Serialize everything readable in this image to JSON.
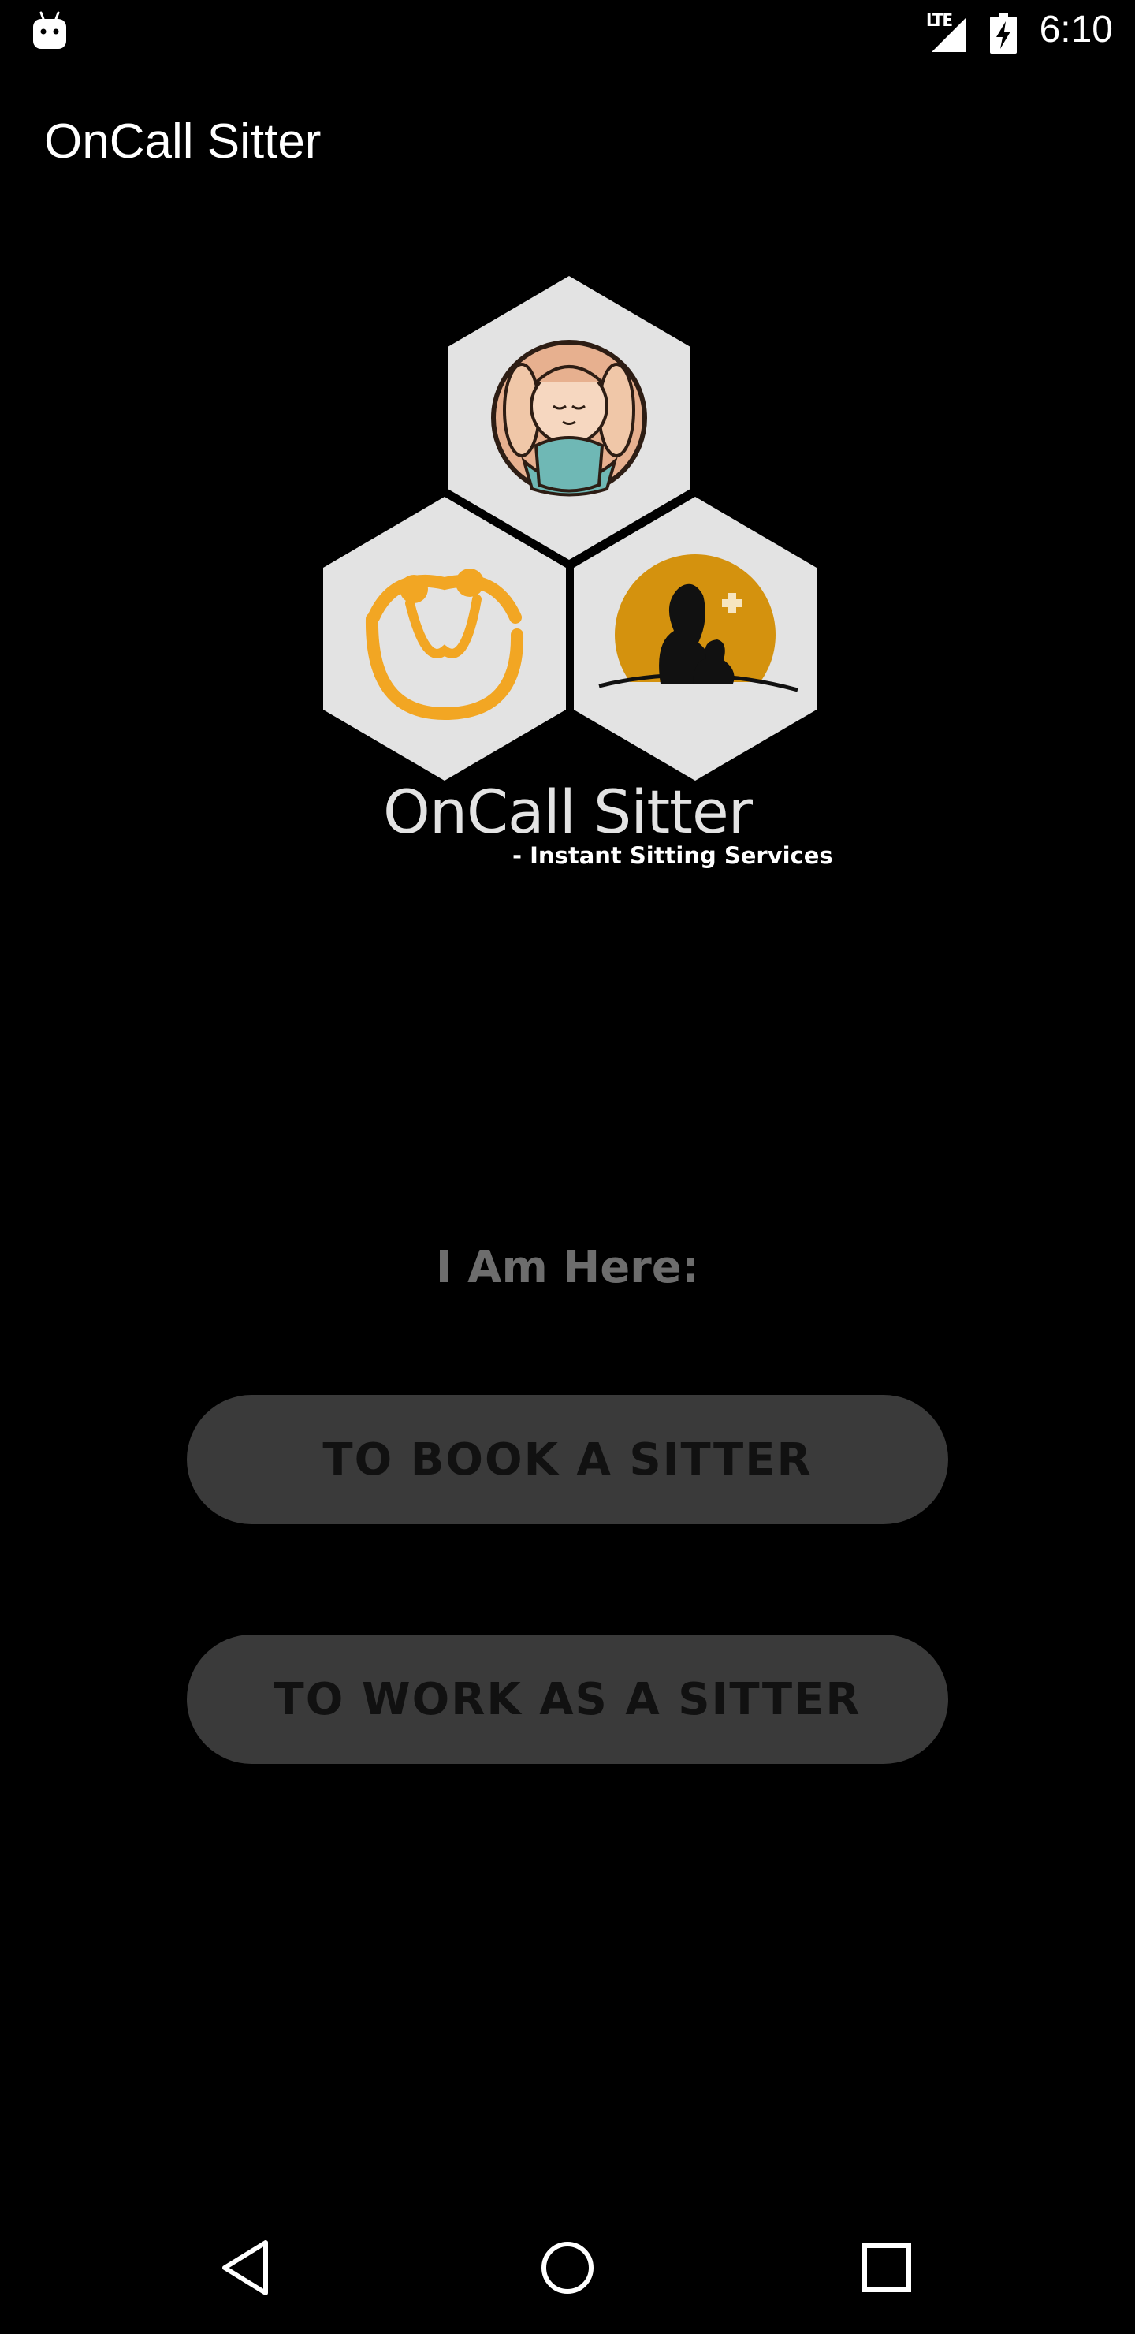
{
  "status_bar": {
    "network_type": "LTE",
    "time": "6:10",
    "icons": [
      "android-notification-icon",
      "signal-icon",
      "battery-charging-icon"
    ]
  },
  "app_bar": {
    "title": "OnCall Sitter"
  },
  "logo": {
    "brand_name": "OnCall Sitter",
    "tagline": "- Instant Sitting Services",
    "icons": [
      "baby-care-icon",
      "elder-care-icon",
      "pet-care-icon"
    ],
    "colors": {
      "hex_fill": "#e3e3e3",
      "baby_skin": "#f2c3a3",
      "baby_swaddle": "#6fb8b5",
      "elder_orange": "#f2a623",
      "pet_gold": "#d4920e"
    }
  },
  "main": {
    "prompt": "I Am Here:",
    "book_button_label": "TO BOOK A SITTER",
    "work_button_label": "TO WORK AS A SITTER"
  },
  "nav_bar": {
    "icons": [
      "back-icon",
      "home-icon",
      "recents-icon"
    ]
  },
  "colors": {
    "background": "#000000",
    "button_bg": "#3a3a3a",
    "button_text": "#111111",
    "prompt_text": "#6d6d6d"
  }
}
